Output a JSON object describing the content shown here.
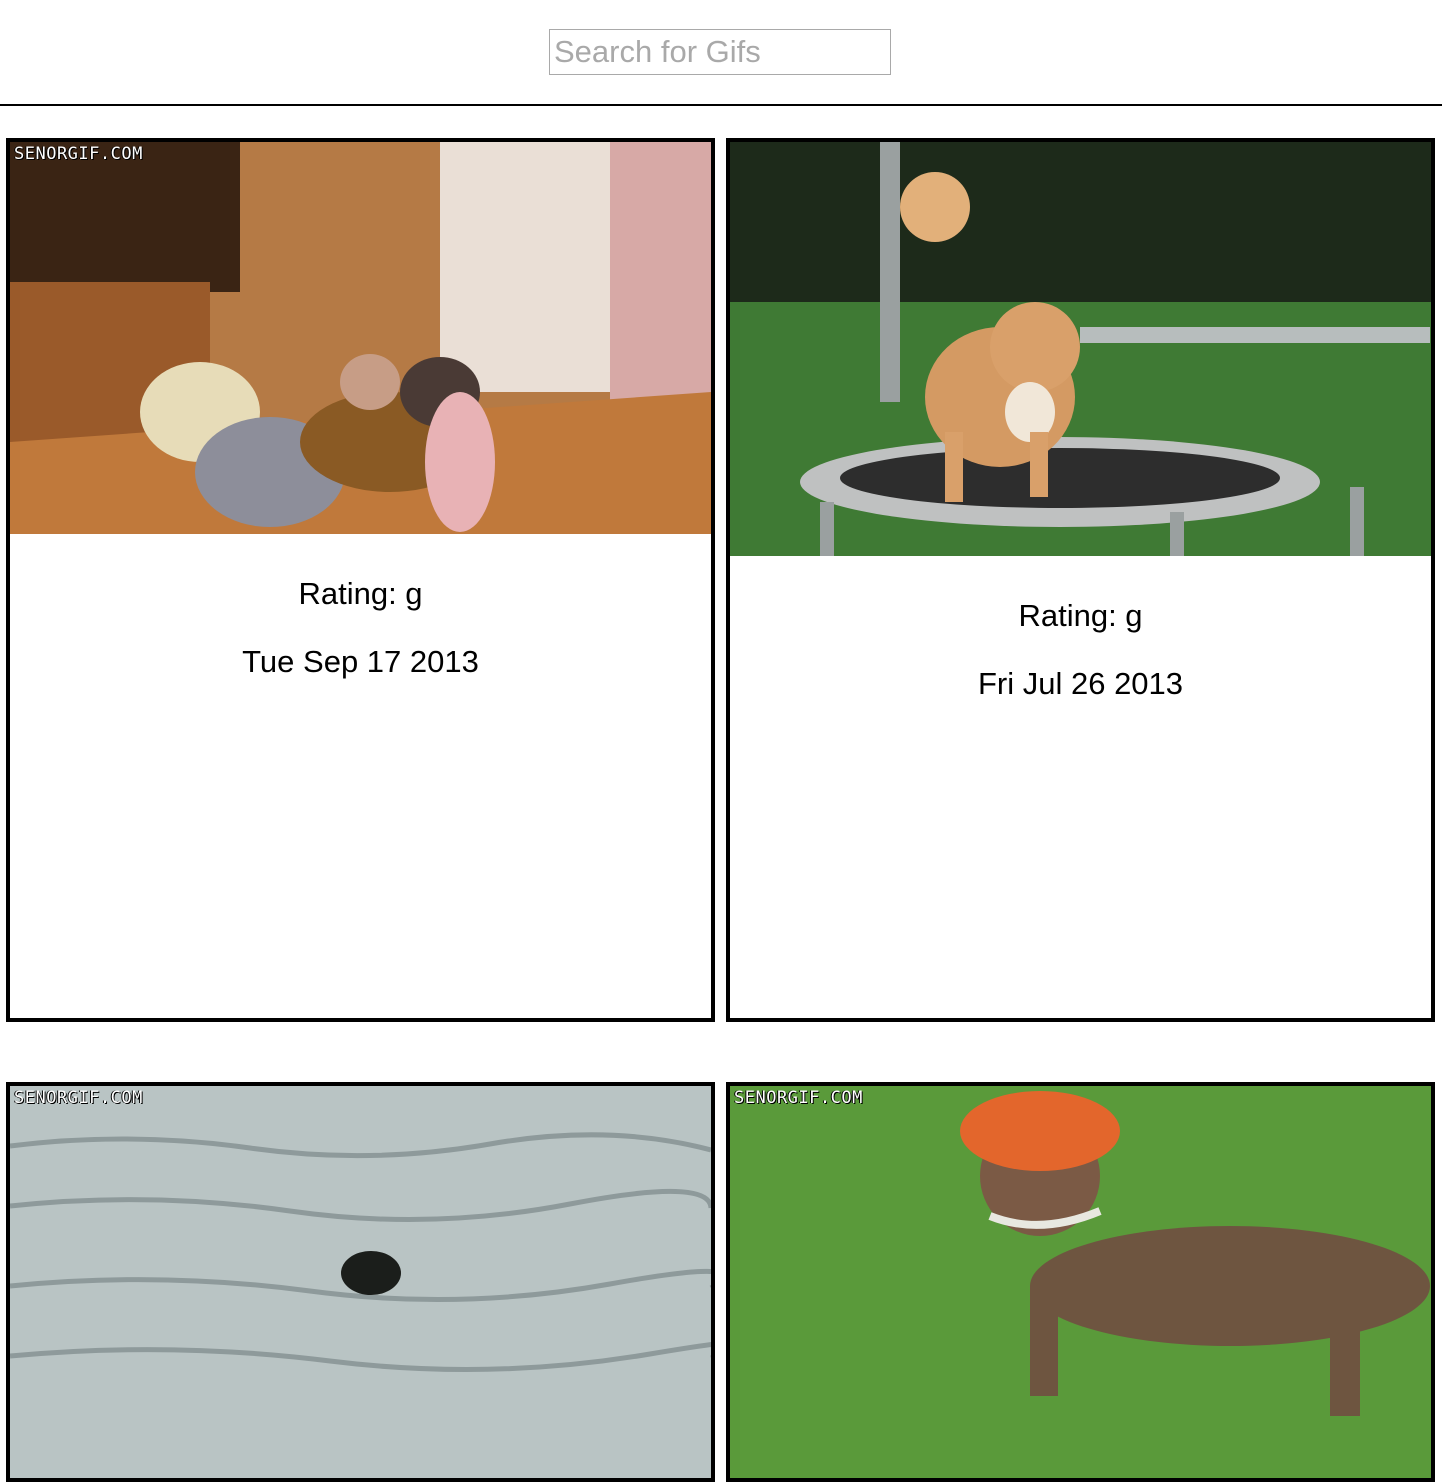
{
  "search": {
    "placeholder": "Search for Gifs",
    "value": ""
  },
  "results": [
    {
      "rating": "Rating: g",
      "date": "Tue Sep 17 2013",
      "watermark": "SENORGIF.COM",
      "subject": "dogs-walking-in-costumes"
    },
    {
      "rating": "Rating: g",
      "date": "Fri Jul 26 2013",
      "watermark": "",
      "subject": "shiba-on-trampoline"
    },
    {
      "rating": "",
      "date": "",
      "watermark": "SENORGIF.COM",
      "subject": "dog-swimming"
    },
    {
      "rating": "",
      "date": "",
      "watermark": "SENORGIF.COM",
      "subject": "dog-with-bucket-on-head"
    }
  ]
}
